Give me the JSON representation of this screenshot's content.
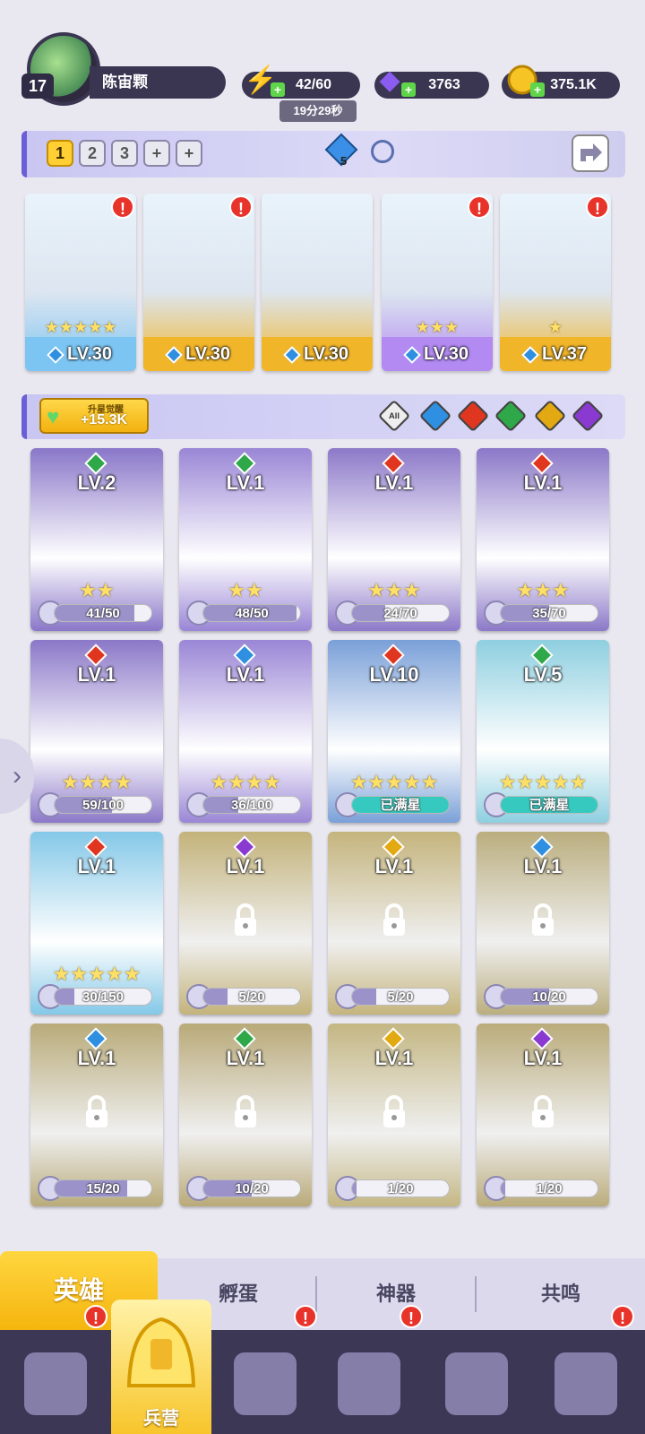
{
  "player": {
    "level": "17",
    "name": "陈宙颗"
  },
  "resources": {
    "energy": {
      "value": "42/60",
      "timer": "19分29秒"
    },
    "gems": {
      "value": "3763"
    },
    "gold": {
      "value": "375.1K"
    }
  },
  "team_slots": [
    "1",
    "2",
    "3",
    "+",
    "+"
  ],
  "team_bar": {
    "crystal_count": "5"
  },
  "team": [
    {
      "level": "LV.30",
      "stars": "★★★★★",
      "element": "water",
      "alert": true,
      "bg": "#7cc4f2"
    },
    {
      "level": "LV.30",
      "stars": "",
      "element": "water",
      "alert": true,
      "bg": "#f1b52a"
    },
    {
      "level": "LV.30",
      "stars": "",
      "element": "water",
      "alert": false,
      "bg": "#f1b52a"
    },
    {
      "level": "LV.30",
      "stars": "★★★",
      "element": "water",
      "alert": true,
      "bg": "#b28af2"
    },
    {
      "level": "LV.37",
      "stars": "★",
      "element": "water",
      "alert": true,
      "bg": "#f1b52a"
    }
  ],
  "awaken": {
    "label": "升星觉醒",
    "value": "+15.3K"
  },
  "filters": [
    "All",
    "water",
    "fire",
    "earth",
    "light",
    "dark"
  ],
  "heroes": [
    {
      "level": "LV.2",
      "element": "earth",
      "stars": "★★",
      "progress": "41/50",
      "ratio": 0.82,
      "locked": false,
      "bg": "#8a77c9"
    },
    {
      "level": "LV.1",
      "element": "earth",
      "stars": "★★",
      "progress": "48/50",
      "ratio": 0.96,
      "locked": false,
      "bg": "#9a86d6"
    },
    {
      "level": "LV.1",
      "element": "fire",
      "stars": "★★★",
      "progress": "24/70",
      "ratio": 0.34,
      "locked": false,
      "bg": "#8d79c9"
    },
    {
      "level": "LV.1",
      "element": "fire",
      "stars": "★★★",
      "progress": "35/70",
      "ratio": 0.5,
      "locked": false,
      "bg": "#8b78c8"
    },
    {
      "level": "LV.1",
      "element": "fire",
      "stars": "★★★★",
      "progress": "59/100",
      "ratio": 0.59,
      "locked": false,
      "bg": "#8b78c8"
    },
    {
      "level": "LV.1",
      "element": "water",
      "stars": "★★★★",
      "progress": "36/100",
      "ratio": 0.36,
      "locked": false,
      "bg": "#9a86d6"
    },
    {
      "level": "LV.10",
      "element": "fire",
      "stars": "★★★★★",
      "progress": "已满星",
      "ratio": 1,
      "locked": false,
      "bg": "#7aa0d8",
      "maxed": true
    },
    {
      "level": "LV.5",
      "element": "earth",
      "stars": "★★★★★",
      "progress": "已满星",
      "ratio": 1,
      "locked": false,
      "bg": "#8ecfe0",
      "maxed": true
    },
    {
      "level": "LV.1",
      "element": "fire",
      "stars": "★★★★★",
      "progress": "30/150",
      "ratio": 0.2,
      "locked": false,
      "bg": "#84c8e8"
    },
    {
      "level": "LV.1",
      "element": "dark",
      "stars": "",
      "progress": "5/20",
      "ratio": 0.25,
      "locked": true,
      "bg": "#c7a73a"
    },
    {
      "level": "LV.1",
      "element": "light",
      "stars": "",
      "progress": "5/20",
      "ratio": 0.25,
      "locked": true,
      "bg": "#c9a93e"
    },
    {
      "level": "LV.1",
      "element": "water",
      "stars": "",
      "progress": "10/20",
      "ratio": 0.5,
      "locked": true,
      "bg": "#b9a045"
    },
    {
      "level": "LV.1",
      "element": "water",
      "stars": "",
      "progress": "15/20",
      "ratio": 0.75,
      "locked": true,
      "bg": "#b79c3c"
    },
    {
      "level": "LV.1",
      "element": "earth",
      "stars": "",
      "progress": "10/20",
      "ratio": 0.5,
      "locked": true,
      "bg": "#b89a3b"
    },
    {
      "level": "LV.1",
      "element": "light",
      "stars": "",
      "progress": "1/20",
      "ratio": 0.05,
      "locked": true,
      "bg": "#c7ad4a"
    },
    {
      "level": "LV.1",
      "element": "dark",
      "stars": "",
      "progress": "1/20",
      "ratio": 0.05,
      "locked": true,
      "bg": "#b99d3f"
    }
  ],
  "subtabs": [
    "英雄",
    "孵蛋",
    "神器",
    "共鸣"
  ],
  "bottom_nav": {
    "active_label": "兵营"
  },
  "colors": {
    "water": "#2f8fe0",
    "fire": "#e0361f",
    "earth": "#2fa84a",
    "light": "#e3a912",
    "dark": "#8a3ad0",
    "alert": "#e8332b",
    "accent": "#f5b50e"
  }
}
